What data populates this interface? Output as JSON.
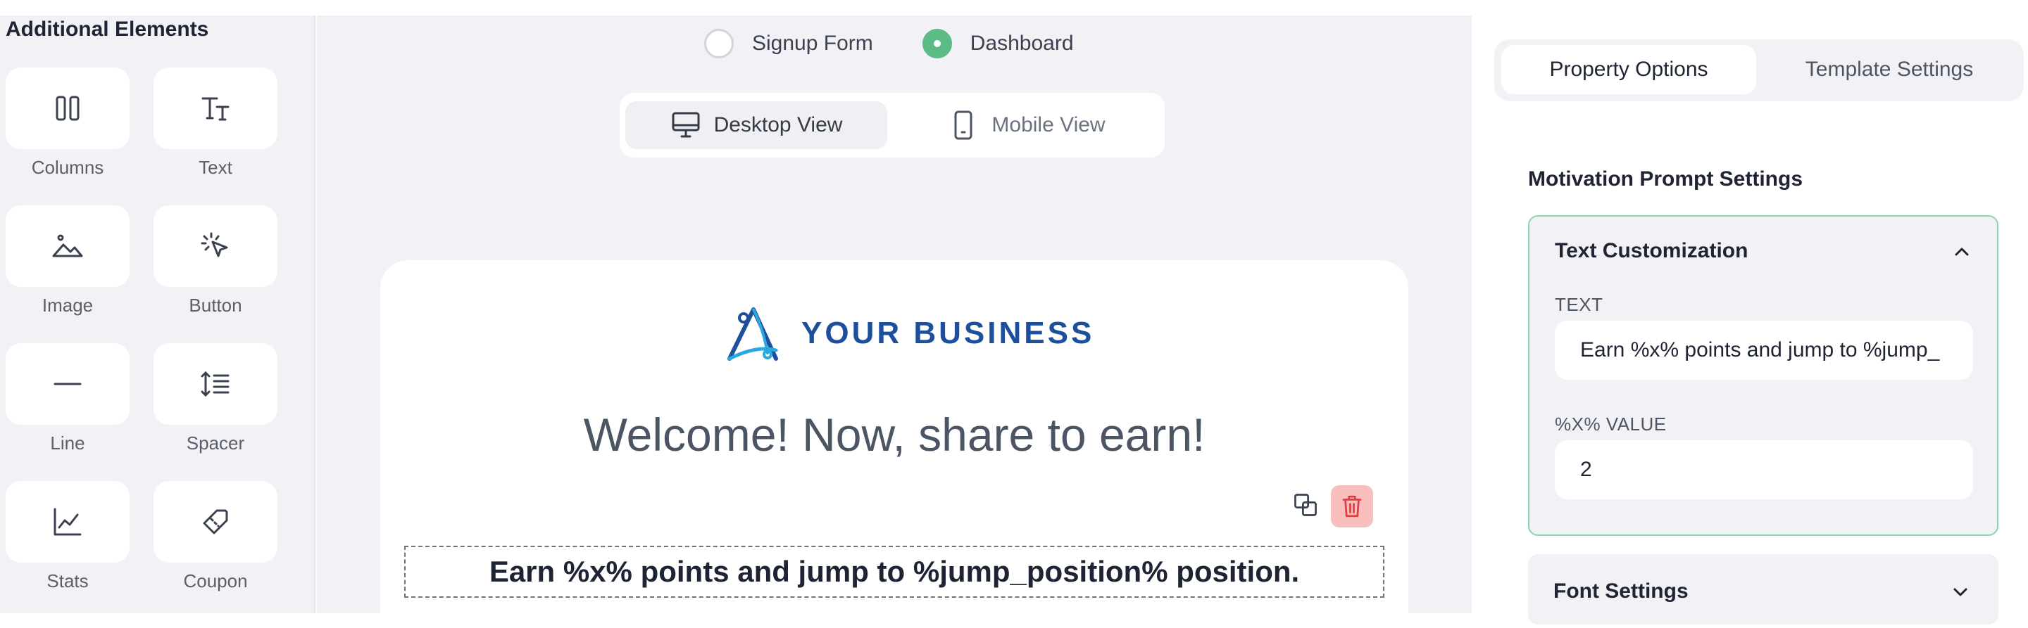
{
  "sidebar": {
    "title": "Additional Elements",
    "items": [
      {
        "label": "Columns",
        "icon": "columns-icon"
      },
      {
        "label": "Text",
        "icon": "text-icon"
      },
      {
        "label": "Image",
        "icon": "image-icon"
      },
      {
        "label": "Button",
        "icon": "cursor-click-icon"
      },
      {
        "label": "Line",
        "icon": "line-icon"
      },
      {
        "label": "Spacer",
        "icon": "spacer-icon"
      },
      {
        "label": "Stats",
        "icon": "stats-icon"
      },
      {
        "label": "Coupon",
        "icon": "coupon-icon"
      }
    ]
  },
  "form_type": {
    "options": [
      {
        "label": "Signup Form",
        "selected": false
      },
      {
        "label": "Dashboard",
        "selected": true
      }
    ]
  },
  "view_toggle": {
    "desktop_label": "Desktop View",
    "mobile_label": "Mobile View",
    "active": "Desktop View"
  },
  "canvas": {
    "logo_text": "YOUR BUSINESS",
    "heading": "Welcome! Now, share to earn!",
    "motivation_text": "Earn %x% points and jump to %jump_position% position."
  },
  "right_panel": {
    "tabs": [
      {
        "label": "Property Options",
        "active": true
      },
      {
        "label": "Template Settings",
        "active": false
      }
    ],
    "section_title": "Motivation Prompt Settings",
    "text_customization": {
      "title": "Text Customization",
      "text_label": "TEXT",
      "text_value": "Earn %x% points and jump to %jump_",
      "x_value_label": "%X% VALUE",
      "x_value": "2"
    },
    "font_settings": {
      "title": "Font Settings"
    }
  },
  "colors": {
    "accent_green": "#5dbb85",
    "accordion_border": "#8ed3ad",
    "brand_blue": "#1d4f9c",
    "delete_bg": "#f8bdbd",
    "delete_icon": "#dc3b3b"
  }
}
